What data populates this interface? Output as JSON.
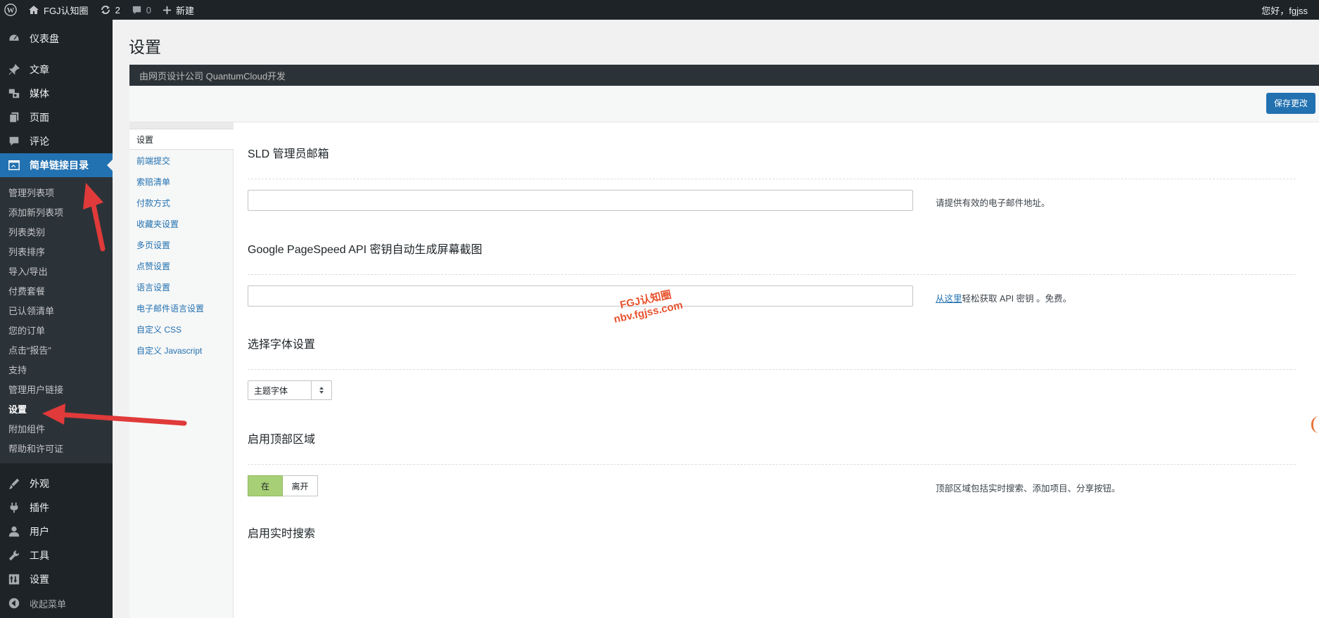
{
  "adminbar": {
    "site_name": "FGJ认知圈",
    "updates_count": "2",
    "comments_count": "0",
    "new_label": "新建",
    "greeting": "您好，fgjss"
  },
  "sidebar": {
    "top_items": [
      {
        "label": "仪表盘",
        "icon": "dashboard-icon"
      },
      {
        "label": "文章",
        "icon": "pin-icon"
      },
      {
        "label": "媒体",
        "icon": "media-icon"
      },
      {
        "label": "页面",
        "icon": "page-icon"
      },
      {
        "label": "评论",
        "icon": "comment-icon"
      }
    ],
    "current": {
      "label": "简单链接目录",
      "icon": "directory-icon"
    },
    "submenu": [
      "管理列表项",
      "添加新列表项",
      "列表类别",
      "列表排序",
      "导入/导出",
      "付费套餐",
      "已认领清单",
      "您的订单",
      "点击“报告”",
      "支持",
      "管理用户链接",
      "设置",
      "附加组件",
      "帮助和许可证"
    ],
    "submenu_current": "设置",
    "bottom_items": [
      {
        "label": "外观",
        "icon": "brush-icon"
      },
      {
        "label": "插件",
        "icon": "plugin-icon"
      },
      {
        "label": "用户",
        "icon": "user-icon"
      },
      {
        "label": "工具",
        "icon": "wrench-icon"
      },
      {
        "label": "设置",
        "icon": "settings-icon"
      }
    ],
    "collapse_label": "收起菜单"
  },
  "page": {
    "title": "设置",
    "vendor_text": "由网页设计公司 QuantumCloud开发",
    "save_button": "保存更改"
  },
  "tabs": [
    "设置",
    "前端提交",
    "索赔清单",
    "付款方式",
    "收藏夹设置",
    "多页设置",
    "点赞设置",
    "语言设置",
    "电子邮件语言设置",
    "自定义 CSS",
    "自定义 Javascript"
  ],
  "active_tab": "设置",
  "sections": {
    "admin_email": {
      "title": "SLD 管理员邮箱",
      "value": "",
      "desc": "请提供有效的电子邮件地址。"
    },
    "pagespeed": {
      "title": "Google PageSpeed API 密钥自动生成屏幕截图",
      "value": "",
      "desc_link": "从这里",
      "desc_rest": "轻松获取 API 密钥 。免费。"
    },
    "font": {
      "title": "选择字体设置",
      "selected": "主题字体"
    },
    "top_area": {
      "title": "启用顶部区域",
      "on_label": "在",
      "off_label": "离开",
      "state": "on",
      "desc": "顶部区域包括实时搜索、添加项目、分享按钮。"
    },
    "live_search": {
      "title": "启用实时搜索"
    }
  },
  "watermark": {
    "line1": "FGJ认知圈",
    "line2": "nbv.fgjss.com"
  },
  "colors": {
    "accent": "#2271b1",
    "sidebar_bg": "#1d2327",
    "toggle_on": "#a7cf76",
    "annotation_arrow": "#e03a3a"
  }
}
